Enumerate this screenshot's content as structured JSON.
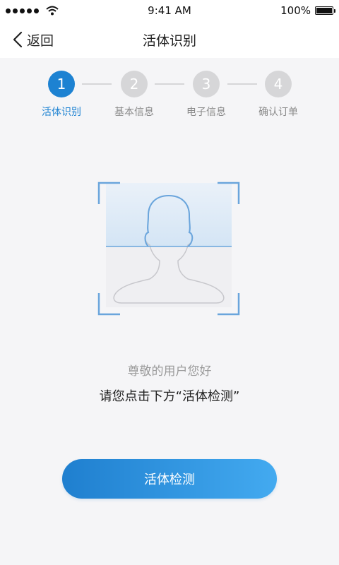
{
  "status_bar": {
    "time": "9:41 AM",
    "battery": "100%",
    "battery_level": 1.0
  },
  "nav": {
    "back_label": "返回",
    "title": "活体识别"
  },
  "steps": [
    {
      "number": "1",
      "label": "活体识别",
      "active": true
    },
    {
      "number": "2",
      "label": "基本信息",
      "active": false
    },
    {
      "number": "3",
      "label": "电子信息",
      "active": false
    },
    {
      "number": "4",
      "label": "确认订单",
      "active": false
    }
  ],
  "main": {
    "greeting": "尊敬的用户您好",
    "instruction": "请您点击下方“活体检测”",
    "button_label": "活体检测"
  },
  "colors": {
    "accent": "#1d82d2",
    "inactive": "#d6d6d8"
  }
}
